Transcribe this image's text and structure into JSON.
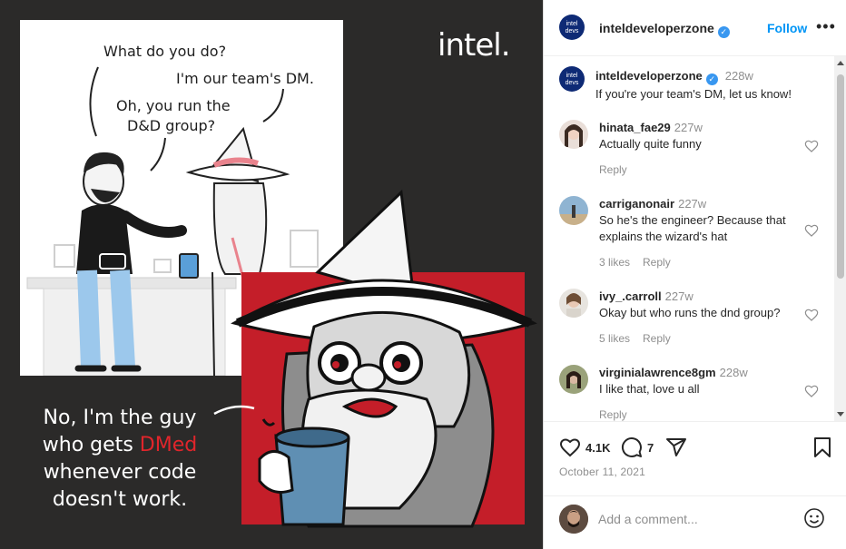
{
  "post": {
    "brand_logo": "intel.",
    "speech": {
      "line1": "What do you do?",
      "line2": "I'm our team's DM.",
      "line3a": "Oh, you run the",
      "line3b": "D&D group?"
    },
    "punchline": {
      "l1": "No, I'm the guy",
      "l2a": "who gets ",
      "l2b": "DMed",
      "l3": "whenever code",
      "l4": "doesn't work."
    }
  },
  "header": {
    "avatar_l1": "intel",
    "avatar_l2": "devs",
    "username": "inteldeveloperzone",
    "follow_label": "Follow",
    "more_icon": "more-horizontal-icon"
  },
  "caption": {
    "username": "inteldeveloperzone",
    "time": "228w",
    "text": "If you're your team's DM, let us know!"
  },
  "comments": [
    {
      "username": "hinata_fae29",
      "time": "227w",
      "line1": "Actually quite funny",
      "line2": "",
      "likes": "",
      "reply": "Reply"
    },
    {
      "username": "carriganonair",
      "time": "227w",
      "line1": "So he's the engineer? Because that",
      "line2": "explains the wizard's hat",
      "likes": "3 likes",
      "reply": "Reply"
    },
    {
      "username": "ivy_.carroll",
      "time": "227w",
      "line1": "Okay but who runs the dnd group?",
      "line2": "",
      "likes": "5 likes",
      "reply": "Reply"
    },
    {
      "username": "virginialawrence8gm",
      "time": "228w",
      "line1": "I like that, love u all",
      "line2": "",
      "likes": "",
      "reply": "Reply"
    }
  ],
  "actions": {
    "likes": "4.1K",
    "comments": "7",
    "date": "October 11, 2021"
  },
  "add_comment": {
    "placeholder": "Add a comment..."
  },
  "colors": {
    "accent": "#0095f6",
    "verified": "#3897f0",
    "brand_red": "#c41e29",
    "dark_bg": "#2b2a29"
  }
}
